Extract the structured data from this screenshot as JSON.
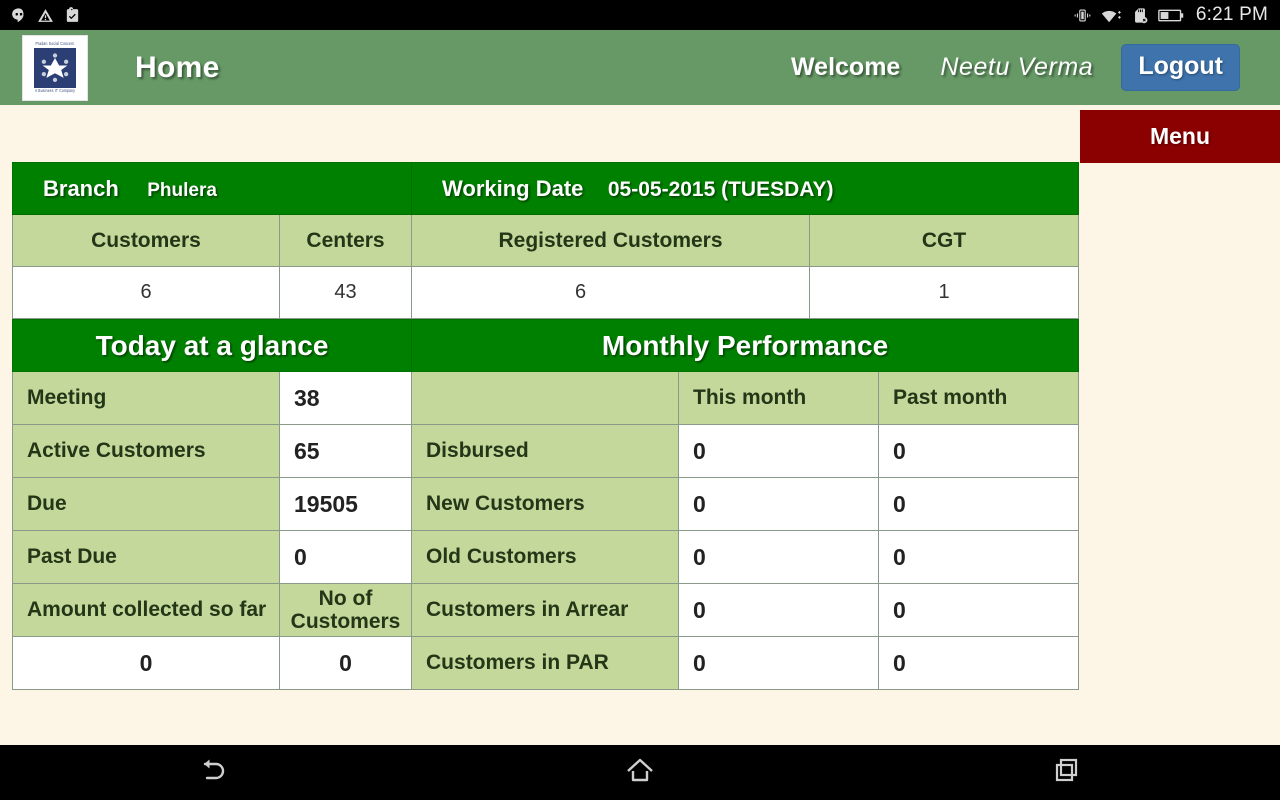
{
  "status_bar": {
    "icons_left": [
      "hangouts-icon",
      "warning-icon",
      "clipboard-check-icon"
    ],
    "icons_right": [
      "vibrate-icon",
      "wifi-icon",
      "sd-card-removed-icon",
      "battery-icon"
    ],
    "clock": "6:21 PM"
  },
  "app_bar": {
    "title": "Home",
    "logo_top_text": "Pradan Social Concern",
    "logo_bottom_text": "A Business IT Company",
    "welcome_label": "Welcome",
    "user_name": "Neetu  Verma",
    "logout_label": "Logout"
  },
  "menu": {
    "label": "Menu"
  },
  "branch_bar": {
    "branch_label": "Branch",
    "branch_value": "Phulera",
    "working_date_label": "Working Date",
    "working_date_value": "05-05-2015 (TUESDAY)"
  },
  "summary": {
    "headers": [
      "Customers",
      "Centers",
      "Registered Customers",
      "CGT"
    ],
    "values": [
      "6",
      "43",
      "6",
      "1"
    ]
  },
  "sections": {
    "today_title": "Today at a glance",
    "monthly_title": "Monthly Performance"
  },
  "today": {
    "rows": [
      {
        "label": "Meeting",
        "value": "38"
      },
      {
        "label": "Active Customers",
        "value": "65"
      },
      {
        "label": "Due",
        "value": "19505"
      },
      {
        "label": "Past Due",
        "value": "0"
      }
    ],
    "footer": {
      "label": "Amount collected so far",
      "sub_label_line1": "No of",
      "sub_label_line2": "Customers",
      "amount_value": "0",
      "customers_value": "0"
    }
  },
  "monthly": {
    "col_headers": [
      "",
      "This month",
      "Past month"
    ],
    "rows": [
      {
        "label": "Disbursed",
        "this_month": "0",
        "past_month": "0"
      },
      {
        "label": "New Customers",
        "this_month": "0",
        "past_month": "0"
      },
      {
        "label": "Old Customers",
        "this_month": "0",
        "past_month": "0"
      },
      {
        "label": "Customers in Arrear",
        "this_month": "0",
        "past_month": "0"
      },
      {
        "label": "Customers in PAR",
        "this_month": "0",
        "past_month": "0"
      }
    ]
  },
  "nav_bar": {
    "buttons": [
      "back-icon",
      "home-icon",
      "recent-apps-icon"
    ]
  },
  "colors": {
    "header_green": "#669966",
    "table_green": "#008000",
    "light_green": "#c3d89a",
    "page_bg": "#fdf6e7",
    "menu_red": "#8b0000",
    "logout_blue": "#3e73ab"
  }
}
